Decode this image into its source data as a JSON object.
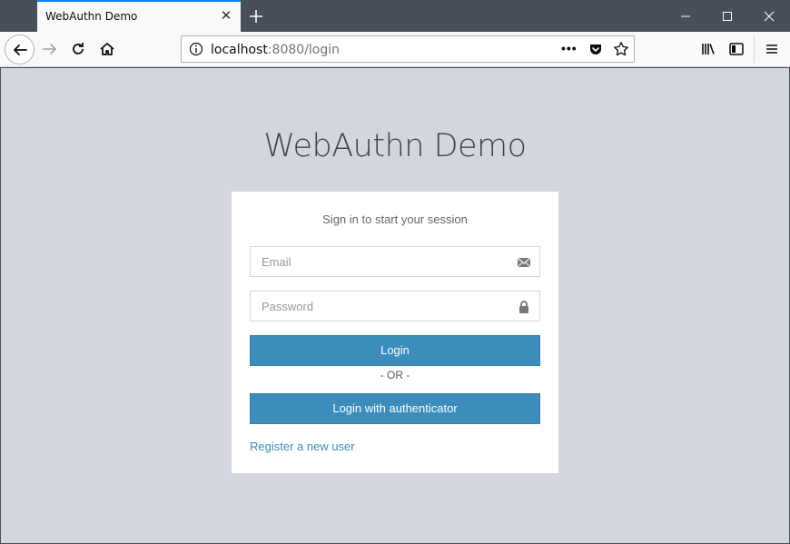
{
  "browser": {
    "tab_title": "WebAuthn Demo",
    "url_host": "localhost",
    "url_rest": ":8080/login",
    "icons": [
      "back-icon",
      "forward-icon",
      "reload-icon",
      "home-icon",
      "info-icon",
      "more-icon",
      "pocket-icon",
      "star-icon",
      "library-icon",
      "sidebar-icon",
      "menu-icon"
    ]
  },
  "page": {
    "title": "WebAuthn Demo",
    "login_message": "Sign in to start your session",
    "email_placeholder": "Email",
    "password_placeholder": "Password",
    "login_button": "Login",
    "or_separator": "- OR -",
    "authenticator_button": "Login with authenticator",
    "register_link": "Register a new user"
  },
  "colors": {
    "accent": "#3c8dbc",
    "background": "#d2d6de",
    "titlebar": "#474f59"
  }
}
